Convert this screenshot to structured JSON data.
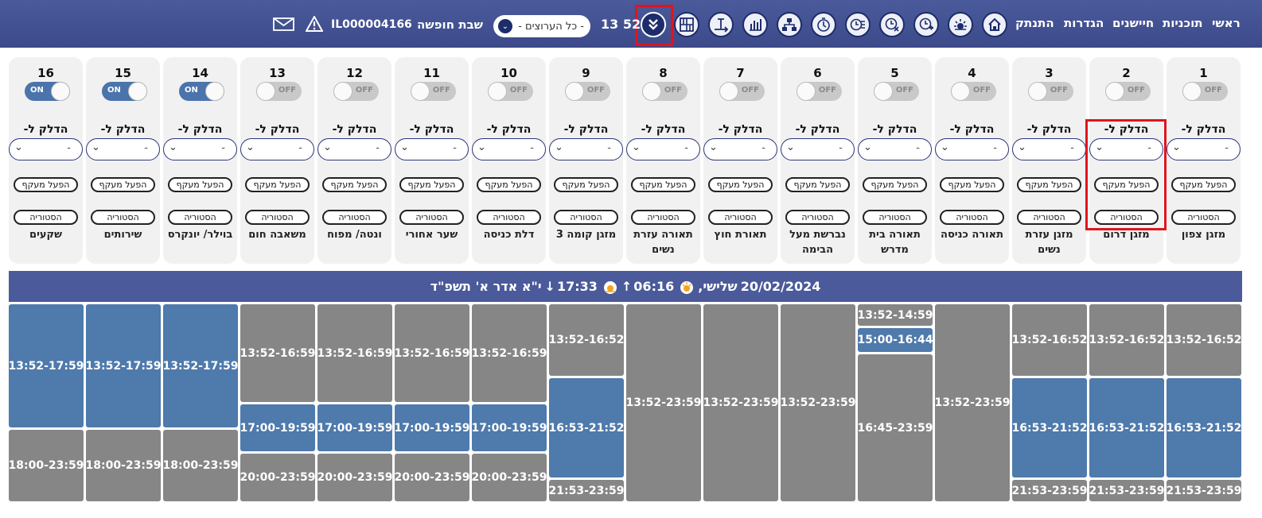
{
  "nav": {
    "home": "ראשי",
    "programs": "תוכניות",
    "sensors": "חיישנים",
    "settings": "הגדרות",
    "logout": "התנתק"
  },
  "header": {
    "time": "13 52",
    "group_select": "- כל הערוצים -",
    "shabbat": "שבת חופשה",
    "device_id": "IL000004166"
  },
  "toolbar_icons": [
    "home-icon",
    "sunset-icon",
    "add-clock-icon",
    "clock-settings-icon",
    "list-clock-icon",
    "timer-icon",
    "network-icon",
    "bar-chart-icon",
    "resize-icon",
    "grid-icon",
    "collapse-icon"
  ],
  "card_labels": {
    "light_to": "הדלק ל-",
    "select_value": "-",
    "bypass": "הפעל מעקף",
    "history": "הסטוריה",
    "on": "ON",
    "off": "OFF"
  },
  "channels": [
    {
      "num": "1",
      "on": false,
      "name": "מזגן צפון"
    },
    {
      "num": "2",
      "on": false,
      "name": "מזגן דרום"
    },
    {
      "num": "3",
      "on": false,
      "name": "מזגן עזרת נשים"
    },
    {
      "num": "4",
      "on": false,
      "name": "תאורה כניסה"
    },
    {
      "num": "5",
      "on": false,
      "name": "תאורה בית מדרש"
    },
    {
      "num": "6",
      "on": false,
      "name": "נברשת מעל הבימה"
    },
    {
      "num": "7",
      "on": false,
      "name": "תאורת חוץ"
    },
    {
      "num": "8",
      "on": false,
      "name": "תאורה עזרת נשים"
    },
    {
      "num": "9",
      "on": false,
      "name": "מזגן קומה 3"
    },
    {
      "num": "10",
      "on": false,
      "name": "דלת כניסה"
    },
    {
      "num": "11",
      "on": false,
      "name": "שער אחורי"
    },
    {
      "num": "12",
      "on": false,
      "name": "ונטה/ מפוח"
    },
    {
      "num": "13",
      "on": false,
      "name": "משאבה חום"
    },
    {
      "num": "14",
      "on": true,
      "name": "בוילר/ יונקרס"
    },
    {
      "num": "15",
      "on": true,
      "name": "שירותים"
    },
    {
      "num": "16",
      "on": true,
      "name": "שקעים"
    }
  ],
  "schedule": {
    "date": "20/02/2024",
    "day": "שלישי,",
    "sunrise": "06:16",
    "sunset": "17:33",
    "hebrew_date": "י\"א אדר א' תשפ\"ד",
    "columns": [
      [
        {
          "t": "13:52-16:52",
          "c": "grey",
          "f": 0.0
        },
        {
          "t": "16:53-21:52",
          "c": "blue",
          "f": 0.0
        },
        {
          "t": "21:53-23:59",
          "c": "grey",
          "f": 0.0
        }
      ],
      [
        {
          "t": "13:52-16:52",
          "c": "grey"
        },
        {
          "t": "16:53-21:52",
          "c": "blue"
        },
        {
          "t": "21:53-23:59",
          "c": "grey"
        }
      ],
      [
        {
          "t": "13:52-16:52",
          "c": "grey"
        },
        {
          "t": "16:53-21:52",
          "c": "blue"
        },
        {
          "t": "21:53-23:59",
          "c": "grey"
        }
      ],
      [
        {
          "t": "13:52-23:59",
          "c": "grey"
        }
      ],
      [
        {
          "t": "13:52-14:59",
          "c": "grey"
        },
        {
          "t": "15:00-16:44",
          "c": "blue"
        },
        {
          "t": "16:45-23:59",
          "c": "grey"
        }
      ],
      [
        {
          "t": "13:52-23:59",
          "c": "grey"
        }
      ],
      [
        {
          "t": "13:52-23:59",
          "c": "grey"
        }
      ],
      [
        {
          "t": "13:52-23:59",
          "c": "grey"
        }
      ],
      [
        {
          "t": "13:52-16:52",
          "c": "grey"
        },
        {
          "t": "16:53-21:52",
          "c": "blue"
        },
        {
          "t": "21:53-23:59",
          "c": "grey"
        }
      ],
      [
        {
          "t": "13:52-16:59",
          "c": "grey"
        },
        {
          "t": "17:00-19:59",
          "c": "blue"
        },
        {
          "t": "20:00-23:59",
          "c": "grey"
        }
      ],
      [
        {
          "t": "13:52-16:59",
          "c": "grey"
        },
        {
          "t": "17:00-19:59",
          "c": "blue"
        },
        {
          "t": "20:00-23:59",
          "c": "grey"
        }
      ],
      [
        {
          "t": "13:52-16:59",
          "c": "grey"
        },
        {
          "t": "17:00-19:59",
          "c": "blue"
        },
        {
          "t": "20:00-23:59",
          "c": "grey"
        }
      ],
      [
        {
          "t": "13:52-16:59",
          "c": "grey"
        },
        {
          "t": "17:00-19:59",
          "c": "blue"
        },
        {
          "t": "20:00-23:59",
          "c": "grey"
        }
      ],
      [
        {
          "t": "13:52-17:59",
          "c": "blue"
        },
        {
          "t": "18:00-23:59",
          "c": "grey"
        }
      ],
      [
        {
          "t": "13:52-17:59",
          "c": "blue"
        },
        {
          "t": "18:00-23:59",
          "c": "grey"
        }
      ],
      [
        {
          "t": "13:52-17:59",
          "c": "blue"
        },
        {
          "t": "18:00-23:59",
          "c": "grey"
        }
      ]
    ]
  }
}
